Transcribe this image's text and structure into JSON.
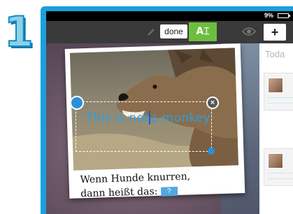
{
  "step": {
    "number": "1"
  },
  "status_bar": {
    "battery_text": "9%"
  },
  "toolbar": {
    "done_label": "done",
    "text_tool_label": "A⌶"
  },
  "canvas": {
    "text_box_before_caret": "This is not",
    "text_box_after_caret": "a monkey",
    "caption_line1": "Wenn Hunde knurren,",
    "caption_line2": "dann heißt das:",
    "blank_label": "?"
  },
  "side_panel": {
    "title": "Toda"
  },
  "icons": {
    "pencil": "pencil-icon",
    "eye": "eye-icon",
    "add": "plus-icon",
    "move": "move-icon",
    "close": "close-icon"
  },
  "colors": {
    "frame": "#1aa0dc",
    "text_tool_active": "#6cbe3f",
    "text_box_text": "#2b9fe0"
  }
}
